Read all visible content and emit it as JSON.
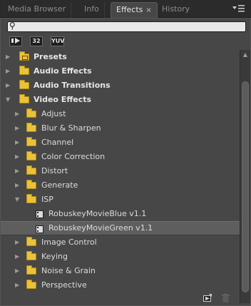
{
  "tabs": [
    {
      "label": "Media Browser",
      "active": false
    },
    {
      "label": "Info",
      "active": false
    },
    {
      "label": "Effects",
      "active": true
    },
    {
      "label": "History",
      "active": false
    }
  ],
  "tab_close_glyph": "×",
  "search": {
    "value": "",
    "placeholder": "",
    "icon": "search-icon"
  },
  "filters": [
    {
      "label": "",
      "icon": "accelerated-effects-icon"
    },
    {
      "label": "32",
      "icon": "32-bit-color-icon"
    },
    {
      "label": "YUV",
      "icon": "yuv-effects-icon"
    }
  ],
  "tree": [
    {
      "label": "Presets",
      "level": 0,
      "kind": "preset-folder",
      "expanded": false
    },
    {
      "label": "Audio Effects",
      "level": 0,
      "kind": "folder",
      "expanded": false
    },
    {
      "label": "Audio Transitions",
      "level": 0,
      "kind": "folder",
      "expanded": false
    },
    {
      "label": "Video Effects",
      "level": 0,
      "kind": "folder",
      "expanded": true
    },
    {
      "label": "Adjust",
      "level": 1,
      "kind": "folder",
      "expanded": false
    },
    {
      "label": "Blur & Sharpen",
      "level": 1,
      "kind": "folder",
      "expanded": false
    },
    {
      "label": "Channel",
      "level": 1,
      "kind": "folder",
      "expanded": false
    },
    {
      "label": "Color Correction",
      "level": 1,
      "kind": "folder",
      "expanded": false
    },
    {
      "label": "Distort",
      "level": 1,
      "kind": "folder",
      "expanded": false
    },
    {
      "label": "Generate",
      "level": 1,
      "kind": "folder",
      "expanded": false
    },
    {
      "label": "ISP",
      "level": 1,
      "kind": "folder",
      "expanded": true
    },
    {
      "label": "RobuskeyMovieBlue v1.1",
      "level": 2,
      "kind": "effect"
    },
    {
      "label": "RobuskeyMovieGreen v1.1",
      "level": 2,
      "kind": "effect",
      "selected": true
    },
    {
      "label": "Image Control",
      "level": 1,
      "kind": "folder",
      "expanded": false
    },
    {
      "label": "Keying",
      "level": 1,
      "kind": "folder",
      "expanded": false
    },
    {
      "label": "Noise & Grain",
      "level": 1,
      "kind": "folder",
      "expanded": false
    },
    {
      "label": "Perspective",
      "level": 1,
      "kind": "folder",
      "expanded": false
    }
  ],
  "panel_menu_icon": "panel-menu-icon",
  "bottom_buttons": [
    {
      "icon": "new-custom-bin-icon"
    },
    {
      "icon": "trash-icon"
    }
  ],
  "colors": {
    "folder": "#e9c23a",
    "panel_bg": "#474747",
    "selected_row": "#5e5e5e"
  }
}
